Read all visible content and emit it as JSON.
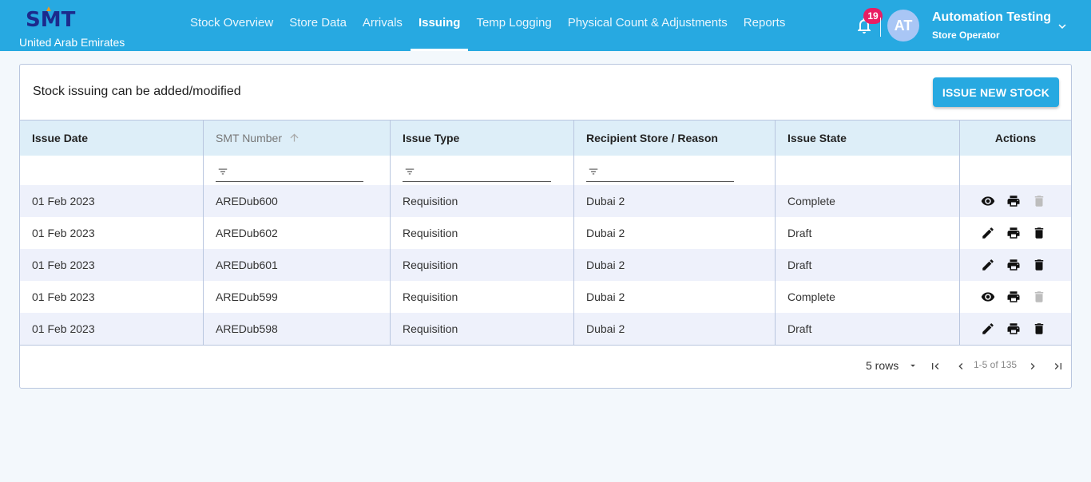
{
  "app": {
    "logo_text": "SMT",
    "country": "United Arab Emirates",
    "brand_color": "#27a9e1"
  },
  "nav": {
    "items": [
      {
        "label": "Stock Overview",
        "active": false
      },
      {
        "label": "Store Data",
        "active": false
      },
      {
        "label": "Arrivals",
        "active": false
      },
      {
        "label": "Issuing",
        "active": true
      },
      {
        "label": "Temp Logging",
        "active": false
      },
      {
        "label": "Physical Count & Adjustments",
        "active": false
      },
      {
        "label": "Reports",
        "active": false
      }
    ]
  },
  "header": {
    "notification_count": "19",
    "avatar_initials": "AT",
    "user_name": "Automation Testing",
    "user_role": "Store Operator"
  },
  "page": {
    "heading": "Stock issuing can be added/modified",
    "issue_button_label": "ISSUE NEW STOCK"
  },
  "table": {
    "columns": [
      "Issue Date",
      "SMT Number",
      "Issue Type",
      "Recipient Store / Reason",
      "Issue State",
      "Actions"
    ],
    "sorted_column": "SMT Number",
    "sort_direction": "ascending",
    "rows": [
      {
        "date": "01 Feb 2023",
        "smt": "AREDub600",
        "type": "Requisition",
        "recipient": "Dubai 2",
        "state": "Complete",
        "actions": [
          "view-icon",
          "print-icon",
          "delete-icon-disabled"
        ]
      },
      {
        "date": "01 Feb 2023",
        "smt": "AREDub602",
        "type": "Requisition",
        "recipient": "Dubai 2",
        "state": "Draft",
        "actions": [
          "edit-icon",
          "print-icon",
          "delete-icon"
        ]
      },
      {
        "date": "01 Feb 2023",
        "smt": "AREDub601",
        "type": "Requisition",
        "recipient": "Dubai 2",
        "state": "Draft",
        "actions": [
          "edit-icon",
          "print-icon",
          "delete-icon"
        ]
      },
      {
        "date": "01 Feb 2023",
        "smt": "AREDub599",
        "type": "Requisition",
        "recipient": "Dubai 2",
        "state": "Complete",
        "actions": [
          "view-icon",
          "print-icon",
          "delete-icon-disabled"
        ]
      },
      {
        "date": "01 Feb 2023",
        "smt": "AREDub598",
        "type": "Requisition",
        "recipient": "Dubai 2",
        "state": "Draft",
        "actions": [
          "edit-icon",
          "print-icon",
          "delete-icon"
        ]
      }
    ]
  },
  "pagination": {
    "rows_per_page": "5 rows",
    "range": "1-5 of 135"
  }
}
